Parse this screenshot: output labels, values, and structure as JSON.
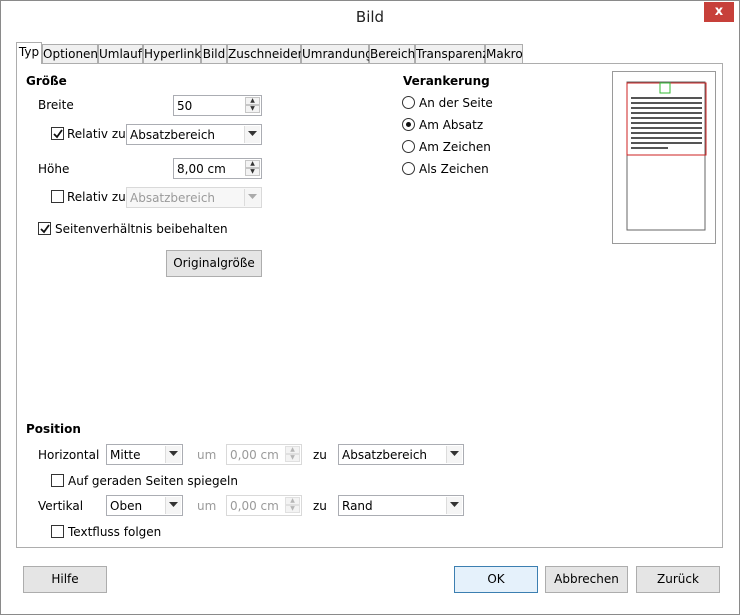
{
  "window": {
    "title": "Bild",
    "close": "x"
  },
  "tabs": [
    {
      "label": "Typ"
    },
    {
      "label": "Optionen"
    },
    {
      "label": "Umlauf"
    },
    {
      "label": "Hyperlink"
    },
    {
      "label": "Bild"
    },
    {
      "label": "Zuschneiden"
    },
    {
      "label": "Umrandung"
    },
    {
      "label": "Bereich"
    },
    {
      "label": "Transparenz"
    },
    {
      "label": "Makro"
    }
  ],
  "size": {
    "heading": "Größe",
    "width_label": "Breite",
    "width_value": "50",
    "width_relative_label": "Relativ zu",
    "width_relative_checked": true,
    "width_relative_to": "Absatzbereich",
    "height_label": "Höhe",
    "height_value": "8,00 cm",
    "height_relative_label": "Relativ zu",
    "height_relative_checked": false,
    "height_relative_to": "Absatzbereich",
    "keep_ratio_label": "Seitenverhältnis beibehalten",
    "keep_ratio_checked": true,
    "original_size_button": "Originalgröße"
  },
  "anchor": {
    "heading": "Verankerung",
    "options": [
      {
        "label": "An der Seite",
        "selected": false
      },
      {
        "label": "Am Absatz",
        "selected": true
      },
      {
        "label": "Am Zeichen",
        "selected": false
      },
      {
        "label": "Als Zeichen",
        "selected": false
      }
    ]
  },
  "position": {
    "heading": "Position",
    "horizontal_label": "Horizontal",
    "horizontal_value": "Mitte",
    "horizontal_by_label": "um",
    "horizontal_by_value": "0,00 cm",
    "horizontal_to_label": "zu",
    "horizontal_to_value": "Absatzbereich",
    "mirror_label": "Auf geraden Seiten spiegeln",
    "mirror_checked": false,
    "vertical_label": "Vertikal",
    "vertical_value": "Oben",
    "vertical_by_label": "um",
    "vertical_by_value": "0,00 cm",
    "vertical_to_label": "zu",
    "vertical_to_value": "Rand",
    "follow_text_flow_label": "Textfluss folgen",
    "follow_text_flow_checked": false
  },
  "buttons": {
    "help": "Hilfe",
    "ok": "OK",
    "cancel": "Abbrechen",
    "reset": "Zurück"
  },
  "colors": {
    "accent": "#3c7fb1",
    "preview_frame": "#cc2222",
    "preview_object": "#33bb33",
    "close": "#c7403a"
  }
}
